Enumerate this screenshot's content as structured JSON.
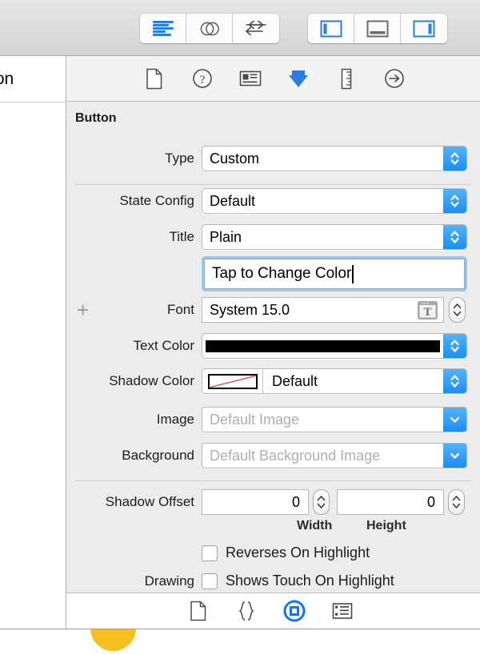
{
  "toolbar": {
    "left_group": [
      {
        "name": "editor-standard",
        "icon": "align-lines-icon",
        "selected": true
      },
      {
        "name": "editor-assistant",
        "icon": "venn-circles-icon",
        "selected": false
      },
      {
        "name": "editor-version",
        "icon": "swap-arrows-icon",
        "selected": false
      }
    ],
    "right_group": [
      {
        "name": "toggle-navigator",
        "icon": "left-panel-icon",
        "selected": true
      },
      {
        "name": "toggle-debug-area",
        "icon": "bottom-panel-icon",
        "selected": false
      },
      {
        "name": "toggle-utilities",
        "icon": "right-panel-icon",
        "selected": true
      }
    ]
  },
  "inspector_tabs": [
    {
      "name": "file-inspector",
      "icon": "file-icon",
      "selected": false
    },
    {
      "name": "quick-help-inspector",
      "icon": "question-circle-icon",
      "selected": false
    },
    {
      "name": "identity-inspector",
      "icon": "identity-card-icon",
      "selected": false
    },
    {
      "name": "attributes-inspector",
      "icon": "attributes-shield-icon",
      "selected": true
    },
    {
      "name": "size-inspector",
      "icon": "ruler-icon",
      "selected": false
    },
    {
      "name": "connections-inspector",
      "icon": "arrow-circle-icon",
      "selected": false
    }
  ],
  "left_stub": {
    "truncated_label": "ton"
  },
  "inspector": {
    "section_title": "Button",
    "type": {
      "label": "Type",
      "value": "Custom"
    },
    "state_config": {
      "label": "State Config",
      "value": "Default"
    },
    "title": {
      "label": "Title",
      "value": "Plain"
    },
    "title_text": {
      "value": "Tap to Change Color"
    },
    "font": {
      "label": "Font",
      "value": "System 15.0",
      "icon": "font-panel-icon"
    },
    "text_color": {
      "label": "Text Color",
      "swatch": "#000000"
    },
    "shadow_color": {
      "label": "Shadow Color",
      "value": "Default",
      "swatch": "none-diagonal"
    },
    "image": {
      "label": "Image",
      "placeholder": "Default Image"
    },
    "background": {
      "label": "Background",
      "placeholder": "Default Background Image"
    },
    "shadow_offset": {
      "label": "Shadow Offset",
      "width_value": "0",
      "height_value": "0",
      "width_label": "Width",
      "height_label": "Height"
    },
    "checkboxes": [
      {
        "name": "reverses-on-highlight",
        "label": "Reverses On Highlight",
        "checked": false
      },
      {
        "name": "shows-touch-on-highlight",
        "label": "Shows Touch On Highlight",
        "checked": false
      }
    ],
    "drawing_label": "Drawing",
    "add_button": "+"
  },
  "bottom_bar": [
    {
      "name": "file-template-library",
      "icon": "file-icon",
      "selected": false
    },
    {
      "name": "code-snippet-library",
      "icon": "braces-icon",
      "selected": false
    },
    {
      "name": "object-library",
      "icon": "circle-square-icon",
      "selected": true
    },
    {
      "name": "media-library",
      "icon": "filmstrip-icon",
      "selected": false
    }
  ],
  "colors": {
    "accent_blue": "#1c8ef5",
    "selected_blue": "#2a7de1",
    "panel_bg": "#ececec",
    "toolbar_bg": "#d9d9d9",
    "focus_ring": "#9cc6ea"
  }
}
